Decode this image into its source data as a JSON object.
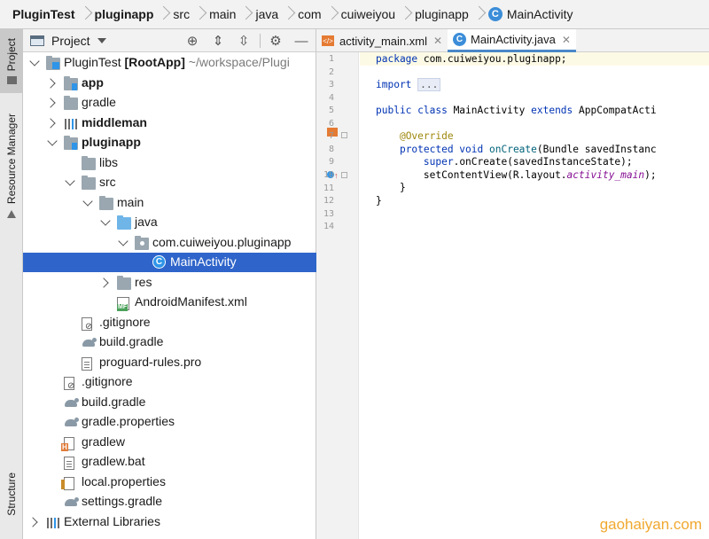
{
  "breadcrumb": [
    {
      "label": "PluginTest",
      "bold": true
    },
    {
      "label": "pluginapp",
      "bold": true
    },
    {
      "label": "src"
    },
    {
      "label": "main"
    },
    {
      "label": "java"
    },
    {
      "label": "com"
    },
    {
      "label": "cuiweiyou"
    },
    {
      "label": "pluginapp"
    },
    {
      "label": "MainActivity",
      "icon": "class-icon"
    }
  ],
  "tool_strip": {
    "project": "Project",
    "resource_manager": "Resource Manager",
    "structure": "Structure"
  },
  "panel": {
    "title": "Project",
    "tools": [
      "crosshair-icon",
      "expand-all-icon",
      "collapse-all-icon",
      "gear-icon",
      "minimize-icon"
    ]
  },
  "tree": [
    {
      "label": "PluginTest",
      "bold_suffix": "[RootApp]",
      "dim_suffix": "~/workspace/Plugi",
      "indent": 0,
      "expand": "down",
      "icon": "root",
      "bold": true
    },
    {
      "label": "app",
      "indent": 1,
      "expand": "right",
      "icon": "module",
      "bold": true
    },
    {
      "label": "gradle",
      "indent": 1,
      "expand": "right",
      "icon": "folder"
    },
    {
      "label": "middleman",
      "indent": 1,
      "expand": "right",
      "icon": "libs",
      "bold": true
    },
    {
      "label": "pluginapp",
      "indent": 1,
      "expand": "down",
      "icon": "module",
      "bold": true
    },
    {
      "label": "libs",
      "indent": 2,
      "expand": "none",
      "icon": "folder"
    },
    {
      "label": "src",
      "indent": 2,
      "expand": "down",
      "icon": "folder"
    },
    {
      "label": "main",
      "indent": 3,
      "expand": "down",
      "icon": "folder"
    },
    {
      "label": "java",
      "indent": 4,
      "expand": "down",
      "icon": "folder-blue"
    },
    {
      "label": "com.cuiweiyou.pluginapp",
      "indent": 5,
      "expand": "down",
      "icon": "package"
    },
    {
      "label": "MainActivity",
      "indent": 6,
      "expand": "none",
      "icon": "class",
      "selected": true
    },
    {
      "label": "res",
      "indent": 4,
      "expand": "right",
      "icon": "folder"
    },
    {
      "label": "AndroidManifest.xml",
      "indent": 4,
      "expand": "none",
      "icon": "manifest"
    },
    {
      "label": ".gitignore",
      "indent": 2,
      "expand": "none",
      "icon": "gitignore"
    },
    {
      "label": "build.gradle",
      "indent": 2,
      "expand": "none",
      "icon": "gradle"
    },
    {
      "label": "proguard-rules.pro",
      "indent": 2,
      "expand": "none",
      "icon": "file"
    },
    {
      "label": ".gitignore",
      "indent": 1,
      "expand": "none",
      "icon": "gitignore"
    },
    {
      "label": "build.gradle",
      "indent": 1,
      "expand": "none",
      "icon": "gradle"
    },
    {
      "label": "gradle.properties",
      "indent": 1,
      "expand": "none",
      "icon": "gradle"
    },
    {
      "label": "gradlew",
      "indent": 1,
      "expand": "none",
      "icon": "gradlew"
    },
    {
      "label": "gradlew.bat",
      "indent": 1,
      "expand": "none",
      "icon": "file"
    },
    {
      "label": "local.properties",
      "indent": 1,
      "expand": "none",
      "icon": "props"
    },
    {
      "label": "settings.gradle",
      "indent": 1,
      "expand": "none",
      "icon": "gradle"
    },
    {
      "label": "External Libraries",
      "indent": 0,
      "expand": "right",
      "icon": "libs"
    }
  ],
  "editor": {
    "tabs": [
      {
        "label": "activity_main.xml",
        "icon": "xml-icon",
        "active": false
      },
      {
        "label": "MainActivity.java",
        "icon": "class-icon",
        "active": true
      }
    ],
    "line_numbers": [
      "1",
      "2",
      "3",
      "4",
      "5",
      "6",
      "7",
      "8",
      "9",
      "10",
      "11",
      "12",
      "13",
      "14"
    ],
    "code": {
      "l1_kw": "package",
      "l1_rest": " com.cuiweiyou.pluginapp;",
      "l3_kw": "import",
      "l3_fold": "...",
      "l5_kw1": "public class",
      "l5_name": " MainActivity ",
      "l5_kw2": "extends",
      "l5_rest": " AppCompatActi",
      "l7_ann": "@Override",
      "l8_kw": "protected void",
      "l8_mt": "onCreate",
      "l8_rest": "(Bundle savedInstanc",
      "l9_kw": "super",
      "l9_rest": ".onCreate(savedInstanceState);",
      "l10_pre": "setContentView(R.layout.",
      "l10_fld": "activity_main",
      "l10_post": ");",
      "l11": "}",
      "l12": "}"
    }
  },
  "watermark": "gaohaiyan.com"
}
